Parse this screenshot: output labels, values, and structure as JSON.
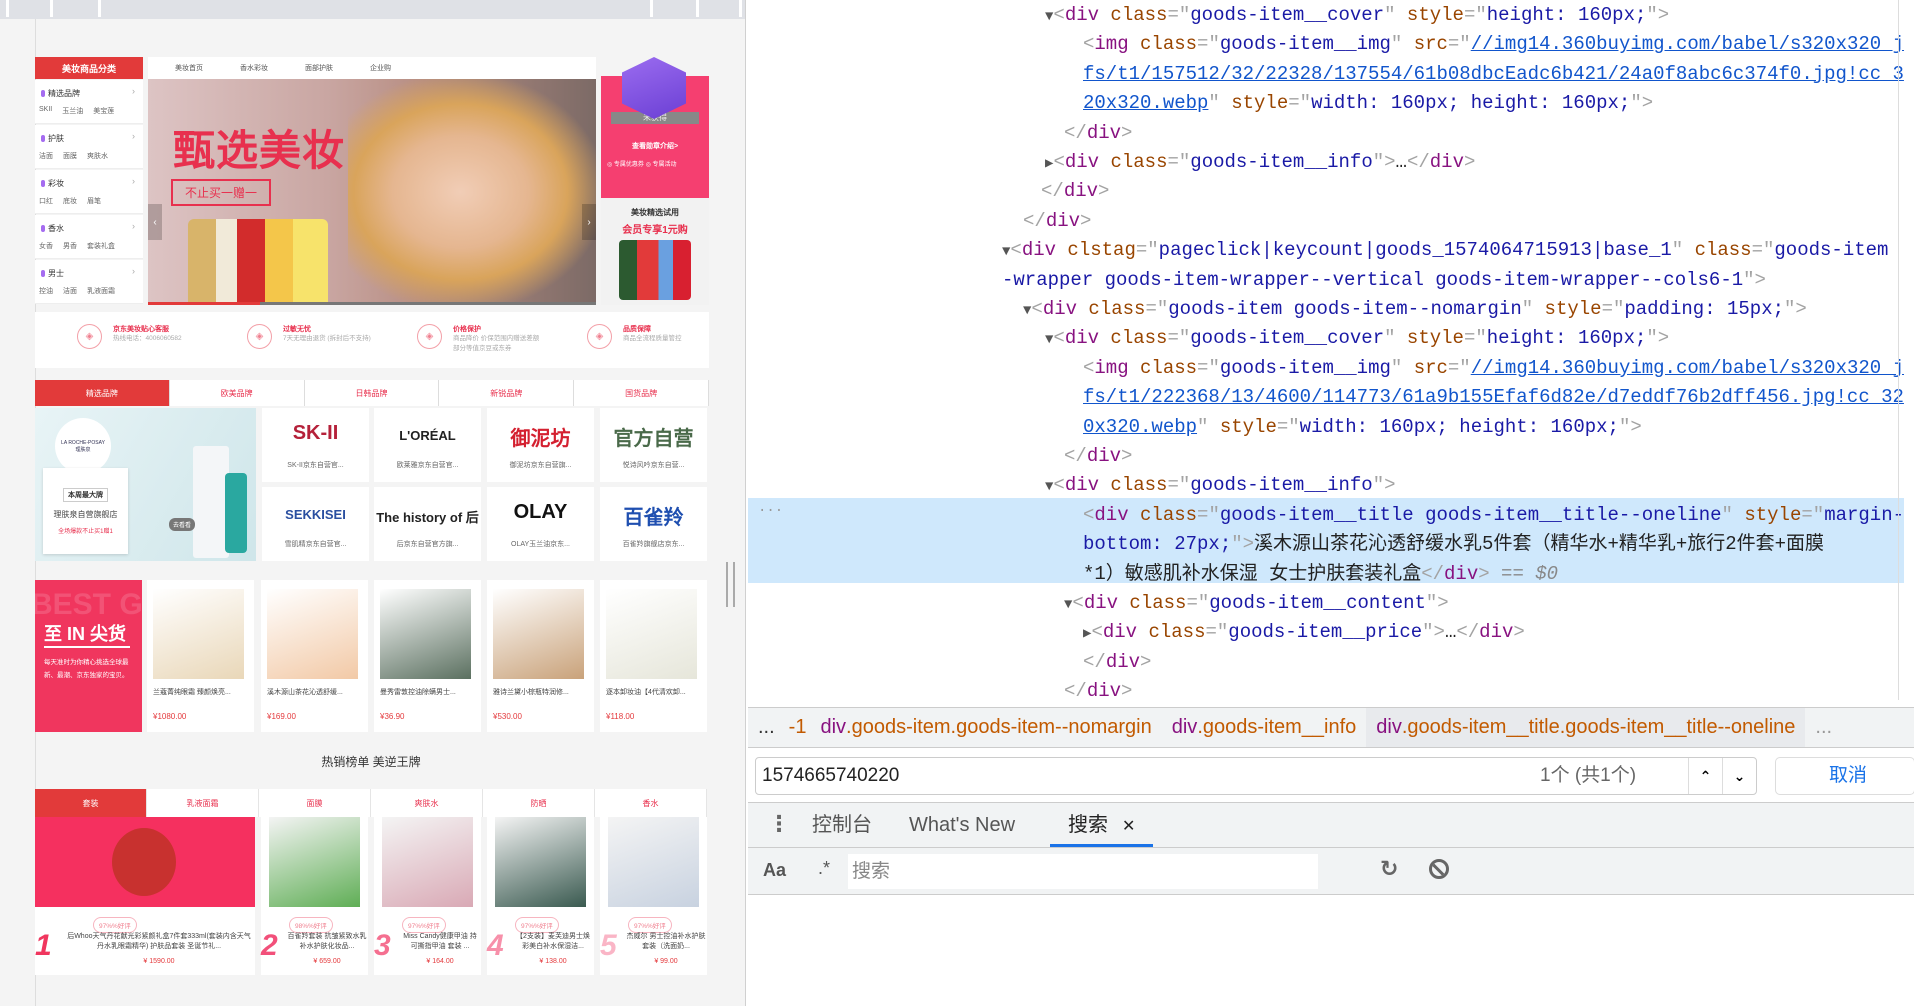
{
  "page": {
    "category_header": "美妆商品分类",
    "categories": [
      {
        "name": "精选品牌",
        "subs": [
          "SKII",
          "玉兰油",
          "美宝莲"
        ]
      },
      {
        "name": "护肤",
        "subs": [
          "洁面",
          "面膜",
          "爽肤水"
        ]
      },
      {
        "name": "彩妆",
        "subs": [
          "口红",
          "底妆",
          "眉笔"
        ]
      },
      {
        "name": "香水",
        "subs": [
          "女香",
          "男香",
          "套装礼盒"
        ]
      },
      {
        "name": "男士",
        "subs": [
          "控油",
          "洁面",
          "乳液面霜"
        ]
      }
    ],
    "nav": [
      "美妆首页",
      "香水彩妆",
      "面部护肤",
      "企业购"
    ],
    "banner": {
      "title": "甄选美妆",
      "subtitle": "不止买一赠一"
    },
    "medal": {
      "status": "未获得",
      "link": "查看勋章介绍>",
      "perk1": "专属优惠券",
      "perk2": "专属活动"
    },
    "trial": {
      "line1": "美妆精选试用",
      "line2": "会员专享1元购"
    },
    "services": [
      {
        "icon": "shield-icon",
        "title": "京东美妆贴心客服",
        "desc": "热线电话：4006060582"
      },
      {
        "icon": "tag-icon",
        "title": "过敏无忧",
        "desc": "7天无理由退货 (拆封后不支持)"
      },
      {
        "icon": "price-protect-icon",
        "title": "价格保护",
        "desc": "商品降价 价保范围内赠送差额部分等值京豆或东券"
      },
      {
        "icon": "free-icon",
        "title": "品质保障",
        "desc": "商品全流程质量管控"
      }
    ],
    "brand_tabs": [
      "精选品牌",
      "欧美品牌",
      "日韩品牌",
      "新锐品牌",
      "国货品牌"
    ],
    "promo": {
      "logo": "LA ROCHE-POSAY 理肤泉",
      "tag": "本周最大牌",
      "store": "理肤泉自营旗舰店",
      "offer": "全场爆款不止买1赠1",
      "go": "去看看"
    },
    "brands": [
      {
        "logo": "SK-II",
        "caption": "SK-II京东自营官...",
        "color": "#b5213a"
      },
      {
        "logo": "L'ORÉAL",
        "caption": "欧莱雅京东自营官...",
        "color": "#222222"
      },
      {
        "logo": "御泥坊",
        "caption": "御泥坊京东自营旗...",
        "color": "#d42030"
      },
      {
        "logo": "官方自营",
        "caption": "悦诗风吟京东自营...",
        "color": "#4a6a4a"
      },
      {
        "logo": "SEKKISEI",
        "caption": "雪肌精京东自营官...",
        "color": "#2a4fa0"
      },
      {
        "logo": "The history of 后",
        "caption": "后京东自营官方旗...",
        "color": "#222222"
      },
      {
        "logo": "OLAY",
        "caption": "OLAY玉兰油京东...",
        "color": "#111111"
      },
      {
        "logo": "百雀羚",
        "caption": "百雀羚旗舰店京东...",
        "color": "#1f4fb0"
      }
    ],
    "in_block": {
      "bg_text": "BEST G",
      "title": "至 IN 尖货",
      "desc": "每天准时为你精心挑选全球最新、最潮、京东独家的宝贝。"
    },
    "products": [
      {
        "title": "兰蔻菁纯眼霜 臻颜焕亮...",
        "price": "¥1080.00",
        "color": "#e9d7b8"
      },
      {
        "title": "溪木源山茶花沁透舒缓...",
        "price": "¥169.00",
        "color": "#f2c9a6"
      },
      {
        "title": "曼秀雷敦控油除螨男士...",
        "price": "¥36.90",
        "color": "#5b7060"
      },
      {
        "title": "雅诗兰黛小棕瓶特润修...",
        "price": "¥530.00",
        "color": "#c9a27a"
      },
      {
        "title": "逐本卸妆油【4代清欢卸...",
        "price": "¥118.00",
        "color": "#e6e6da"
      }
    ],
    "section_title": "热销榜单 美逆王牌",
    "rank_tabs": [
      "套装",
      "乳液面霜",
      "面膜",
      "爽肤水",
      "防晒",
      "香水"
    ],
    "ranking": [
      {
        "rank": "1",
        "rating": "97%%好评",
        "title": "后Whoo天气丹花献光彩紧颜礼盒7件套333ml(套装内含天气丹水乳眼霜精华) 护肤品套装 圣诞节礼...",
        "price": "¥ 1590.00",
        "color": "#e9304e"
      },
      {
        "rank": "2",
        "rating": "98%%好评",
        "title": "百雀羚套装 抗皱紧致水乳补水护肤化妆品...",
        "price": "¥ 659.00",
        "color": "#5fae55"
      },
      {
        "rank": "3",
        "rating": "97%%好评",
        "title": "Miss Candy健康甲油 持可撕指甲油 套装 ...",
        "price": "¥ 164.00",
        "color": "#d9a9b5"
      },
      {
        "rank": "4",
        "rating": "97%%好评",
        "title": "【2支装】麦芙迪男士焕彩美白补水保湿洁...",
        "price": "¥ 138.00",
        "color": "#3a5a50"
      },
      {
        "rank": "5",
        "rating": "97%%好评",
        "title": "杰威尔 男士控油补水护肤套装（洗面奶...",
        "price": "¥ 99.00",
        "color": "#c8d2e0"
      }
    ]
  },
  "devtools": {
    "code_lines": [
      [
        [
          "a",
          "▼"
        ],
        [
          "p",
          "<"
        ],
        [
          "t",
          "div"
        ],
        [
          "n",
          " class"
        ],
        [
          "p",
          "=\""
        ],
        [
          "v",
          "goods-item__cover"
        ],
        [
          "p",
          "\""
        ],
        [
          "n",
          " style"
        ],
        [
          "p",
          "=\""
        ],
        [
          "v",
          "height: 160px;"
        ],
        [
          "p",
          "\">"
        ]
      ],
      [
        [
          "p",
          "<"
        ],
        [
          "t",
          "img"
        ],
        [
          "n",
          " class"
        ],
        [
          "p",
          "=\""
        ],
        [
          "v",
          "goods-item__img"
        ],
        [
          "p",
          "\""
        ],
        [
          "n",
          " src"
        ],
        [
          "p",
          "=\""
        ],
        [
          "l",
          "//img14.360buyimg.com/babel/s320x320_j"
        ]
      ],
      [
        [
          "l",
          "fs/t1/157512/32/22328/137554/61b08dbcEadc6b421/24a0f8abc6c374f0.jpg!cc_3"
        ]
      ],
      [
        [
          "l",
          "20x320.webp"
        ],
        [
          "p",
          "\""
        ],
        [
          "n",
          " style"
        ],
        [
          "p",
          "=\""
        ],
        [
          "v",
          "width: 160px; height: 160px;"
        ],
        [
          "p",
          "\">"
        ]
      ],
      [
        [
          "p",
          "</"
        ],
        [
          "t",
          "div"
        ],
        [
          "p",
          ">"
        ]
      ],
      [
        [
          "a",
          "▶"
        ],
        [
          "p",
          "<"
        ],
        [
          "t",
          "div"
        ],
        [
          "n",
          " class"
        ],
        [
          "p",
          "=\""
        ],
        [
          "v",
          "goods-item__info"
        ],
        [
          "p",
          "\">"
        ],
        [
          "x",
          "…"
        ],
        [
          "p",
          "</"
        ],
        [
          "t",
          "div"
        ],
        [
          "p",
          ">"
        ]
      ],
      [
        [
          "p",
          "</"
        ],
        [
          "t",
          "div"
        ],
        [
          "p",
          ">"
        ]
      ],
      [
        [
          "p",
          "</"
        ],
        [
          "t",
          "div"
        ],
        [
          "p",
          ">"
        ]
      ],
      [
        [
          "a",
          "▼"
        ],
        [
          "p",
          "<"
        ],
        [
          "t",
          "div"
        ],
        [
          "n",
          " clstag"
        ],
        [
          "p",
          "=\""
        ],
        [
          "v",
          "pageclick|keycount|goods_1574064715913|base_1"
        ],
        [
          "p",
          "\""
        ],
        [
          "n",
          " class"
        ],
        [
          "p",
          "=\""
        ],
        [
          "v",
          "goods-item"
        ]
      ],
      [
        [
          "v",
          "-wrapper goods-item-wrapper--vertical goods-item-wrapper--cols6-1"
        ],
        [
          "p",
          "\">"
        ]
      ],
      [
        [
          "a",
          "▼"
        ],
        [
          "p",
          "<"
        ],
        [
          "t",
          "div"
        ],
        [
          "n",
          " class"
        ],
        [
          "p",
          "=\""
        ],
        [
          "v",
          "goods-item goods-item--nomargin"
        ],
        [
          "p",
          "\""
        ],
        [
          "n",
          " style"
        ],
        [
          "p",
          "=\""
        ],
        [
          "v",
          "padding: 15px;"
        ],
        [
          "p",
          "\">"
        ]
      ],
      [
        [
          "a",
          "▼"
        ],
        [
          "p",
          "<"
        ],
        [
          "t",
          "div"
        ],
        [
          "n",
          " class"
        ],
        [
          "p",
          "=\""
        ],
        [
          "v",
          "goods-item__cover"
        ],
        [
          "p",
          "\""
        ],
        [
          "n",
          " style"
        ],
        [
          "p",
          "=\""
        ],
        [
          "v",
          "height: 160px;"
        ],
        [
          "p",
          "\">"
        ]
      ],
      [
        [
          "p",
          "<"
        ],
        [
          "t",
          "img"
        ],
        [
          "n",
          " class"
        ],
        [
          "p",
          "=\""
        ],
        [
          "v",
          "goods-item__img"
        ],
        [
          "p",
          "\""
        ],
        [
          "n",
          " src"
        ],
        [
          "p",
          "=\""
        ],
        [
          "l",
          "//img14.360buyimg.com/babel/s320x320_j"
        ]
      ],
      [
        [
          "l",
          "fs/t1/222368/13/4600/114773/61a9b155Efaf6d82e/d7eddf76b2dff456.jpg!cc_32"
        ]
      ],
      [
        [
          "l",
          "0x320.webp"
        ],
        [
          "p",
          "\""
        ],
        [
          "n",
          " style"
        ],
        [
          "p",
          "=\""
        ],
        [
          "v",
          "width: 160px; height: 160px;"
        ],
        [
          "p",
          "\">"
        ]
      ],
      [
        [
          "p",
          "</"
        ],
        [
          "t",
          "div"
        ],
        [
          "p",
          ">"
        ]
      ],
      [
        [
          "a",
          "▼"
        ],
        [
          "p",
          "<"
        ],
        [
          "t",
          "div"
        ],
        [
          "n",
          " class"
        ],
        [
          "p",
          "=\""
        ],
        [
          "v",
          "goods-item__info"
        ],
        [
          "p",
          "\">"
        ]
      ],
      [
        [
          "p",
          "<"
        ],
        [
          "t",
          "div"
        ],
        [
          "n",
          " class"
        ],
        [
          "p",
          "=\""
        ],
        [
          "v",
          "goods-item__title goods-item__title--oneline"
        ],
        [
          "p",
          "\""
        ],
        [
          "n",
          " style"
        ],
        [
          "p",
          "=\""
        ],
        [
          "v",
          "margin-"
        ]
      ],
      [
        [
          "v",
          "bottom: 27px;"
        ],
        [
          "p",
          "\">"
        ],
        [
          "x",
          "溪木源山茶花沁透舒缓水乳5件套（精华水+精华乳+旅行2件套+面膜"
        ]
      ],
      [
        [
          "x",
          "*1）敏感肌补水保湿 女士护肤套装礼盒"
        ],
        [
          "p",
          "</"
        ],
        [
          "t",
          "div"
        ],
        [
          "p",
          ">"
        ],
        [
          "e",
          " == $0"
        ]
      ],
      [
        [
          "a",
          "▼"
        ],
        [
          "p",
          "<"
        ],
        [
          "t",
          "div"
        ],
        [
          "n",
          " class"
        ],
        [
          "p",
          "=\""
        ],
        [
          "v",
          "goods-item__content"
        ],
        [
          "p",
          "\">"
        ]
      ],
      [
        [
          "a",
          "▶"
        ],
        [
          "p",
          "<"
        ],
        [
          "t",
          "div"
        ],
        [
          "n",
          " class"
        ],
        [
          "p",
          "=\""
        ],
        [
          "v",
          "goods-item__price"
        ],
        [
          "p",
          "\">"
        ],
        [
          "x",
          "…"
        ],
        [
          "p",
          "</"
        ],
        [
          "t",
          "div"
        ],
        [
          "p",
          ">"
        ]
      ],
      [
        [
          "p",
          "</"
        ],
        [
          "t",
          "div"
        ],
        [
          "p",
          ">"
        ]
      ],
      [
        [
          "p",
          "</"
        ],
        [
          "t",
          "div"
        ],
        [
          "p",
          ">"
        ]
      ]
    ],
    "ellipsis": "...",
    "breadcrumbs": {
      "more_left": "...",
      "partial": "-1",
      "items": [
        {
          "tag": "div",
          "cls": ".goods-item.goods-item--nomargin"
        },
        {
          "tag": "div",
          "cls": ".goods-item__info"
        },
        {
          "tag": "div",
          "cls": ".goods-item__title.goods-item__title--oneline"
        }
      ],
      "more_right": "..."
    },
    "find": {
      "value": "1574665740220",
      "count": "1个 (共1个)",
      "cancel": "取消"
    },
    "drawer_tabs": [
      {
        "label": "控制台"
      },
      {
        "label": "What's New"
      },
      {
        "label": "搜索",
        "active": true
      }
    ],
    "search": {
      "case_label": "Aa",
      "regex_label": ".*",
      "placeholder": "搜索"
    }
  }
}
